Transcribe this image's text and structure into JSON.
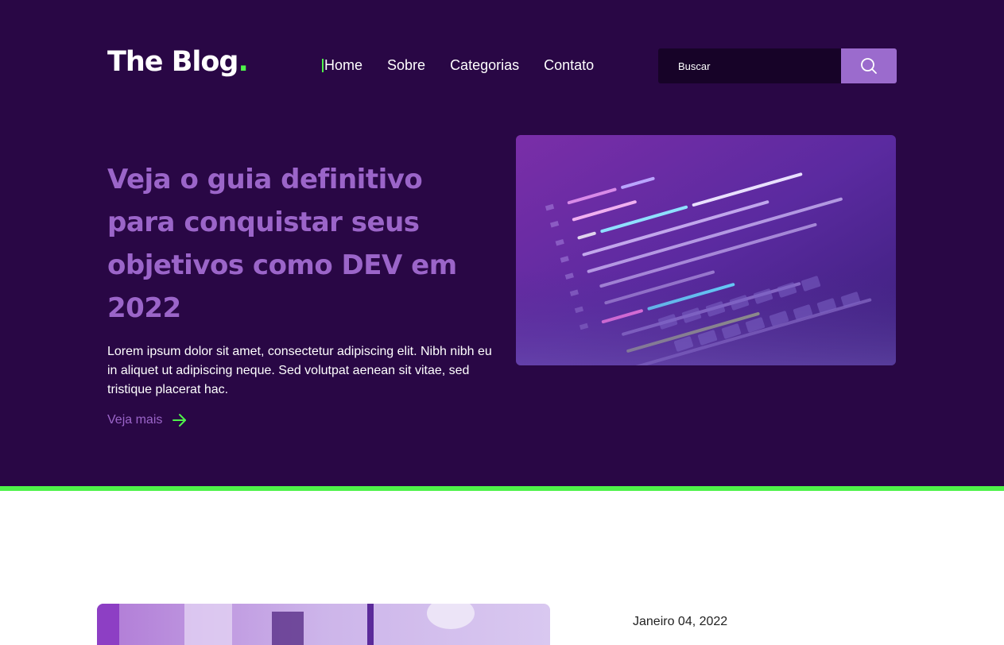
{
  "header": {
    "logo_text": "The Blog",
    "logo_dot": ".",
    "nav": [
      {
        "label": "Home",
        "active": true
      },
      {
        "label": "Sobre",
        "active": false
      },
      {
        "label": "Categorias",
        "active": false
      },
      {
        "label": "Contato",
        "active": false
      }
    ],
    "search": {
      "placeholder": "Buscar",
      "button_icon": "search-icon"
    }
  },
  "hero": {
    "title": "Veja o guia definitivo para conquistar seus objetivos como DEV em 2022",
    "text": "Lorem ipsum dolor sit amet, consectetur adipiscing elit. Nibh nibh eu in aliquet ut adipiscing neque. Sed volutpat aenean sit vitae, sed tristique placerat hac.",
    "link_label": "Veja mais",
    "link_icon": "arrow-right-icon",
    "image_alt": "code on laptop screen"
  },
  "post": {
    "date": "Janeiro 04, 2022"
  },
  "colors": {
    "hero_bg": "#290745",
    "accent_green": "#4ff34a",
    "accent_purple": "#9b65c9",
    "search_bg": "#170328"
  }
}
